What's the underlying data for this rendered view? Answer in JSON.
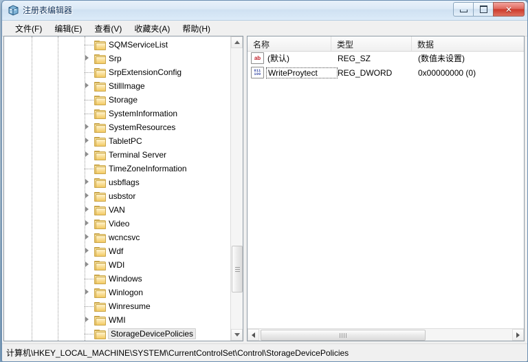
{
  "window": {
    "title": "注册表编辑器",
    "icon": "registry-editor-icon",
    "controls": {
      "minimize": "－",
      "maximize": "□",
      "close": "✕"
    }
  },
  "menu": [
    {
      "label": "文件(F)"
    },
    {
      "label": "编辑(E)"
    },
    {
      "label": "查看(V)"
    },
    {
      "label": "收藏夹(A)"
    },
    {
      "label": "帮助(H)"
    }
  ],
  "tree": {
    "items": [
      {
        "label": "SQMServiceList",
        "expandable": false
      },
      {
        "label": "Srp",
        "expandable": true
      },
      {
        "label": "SrpExtensionConfig",
        "expandable": false
      },
      {
        "label": "StillImage",
        "expandable": true
      },
      {
        "label": "Storage",
        "expandable": false
      },
      {
        "label": "SystemInformation",
        "expandable": false
      },
      {
        "label": "SystemResources",
        "expandable": true
      },
      {
        "label": "TabletPC",
        "expandable": true
      },
      {
        "label": "Terminal Server",
        "expandable": true
      },
      {
        "label": "TimeZoneInformation",
        "expandable": false
      },
      {
        "label": "usbflags",
        "expandable": true
      },
      {
        "label": "usbstor",
        "expandable": true
      },
      {
        "label": "VAN",
        "expandable": true
      },
      {
        "label": "Video",
        "expandable": true
      },
      {
        "label": "wcncsvc",
        "expandable": true
      },
      {
        "label": "Wdf",
        "expandable": true
      },
      {
        "label": "WDI",
        "expandable": true
      },
      {
        "label": "Windows",
        "expandable": false
      },
      {
        "label": "Winlogon",
        "expandable": true
      },
      {
        "label": "Winresume",
        "expandable": false
      },
      {
        "label": "WMI",
        "expandable": true
      },
      {
        "label": "StorageDevicePolicies",
        "expandable": false,
        "selected": true
      }
    ]
  },
  "list": {
    "columns": [
      {
        "label": "名称"
      },
      {
        "label": "类型"
      },
      {
        "label": "数据"
      }
    ],
    "rows": [
      {
        "icon": "string-value-icon",
        "icon_text": "ab",
        "name": "(默认)",
        "type": "REG_SZ",
        "data": "(数值未设置)",
        "focused": false
      },
      {
        "icon": "dword-value-icon",
        "icon_top": "011",
        "icon_bottom": "100",
        "name": "WriteProytect",
        "type": "REG_DWORD",
        "data": "0x00000000 (0)",
        "focused": true
      }
    ]
  },
  "statusbar": {
    "path": "计算机\\HKEY_LOCAL_MACHINE\\SYSTEM\\CurrentControlSet\\Control\\StorageDevicePolicies"
  },
  "colors": {
    "title_text": "#11335c",
    "close_button": "#cc3b2c",
    "folder": "#f3ca63",
    "string_icon_text": "#c0202a",
    "dword_icon_text": "#2b3fa0",
    "selection_bg": "#eaeaea"
  }
}
